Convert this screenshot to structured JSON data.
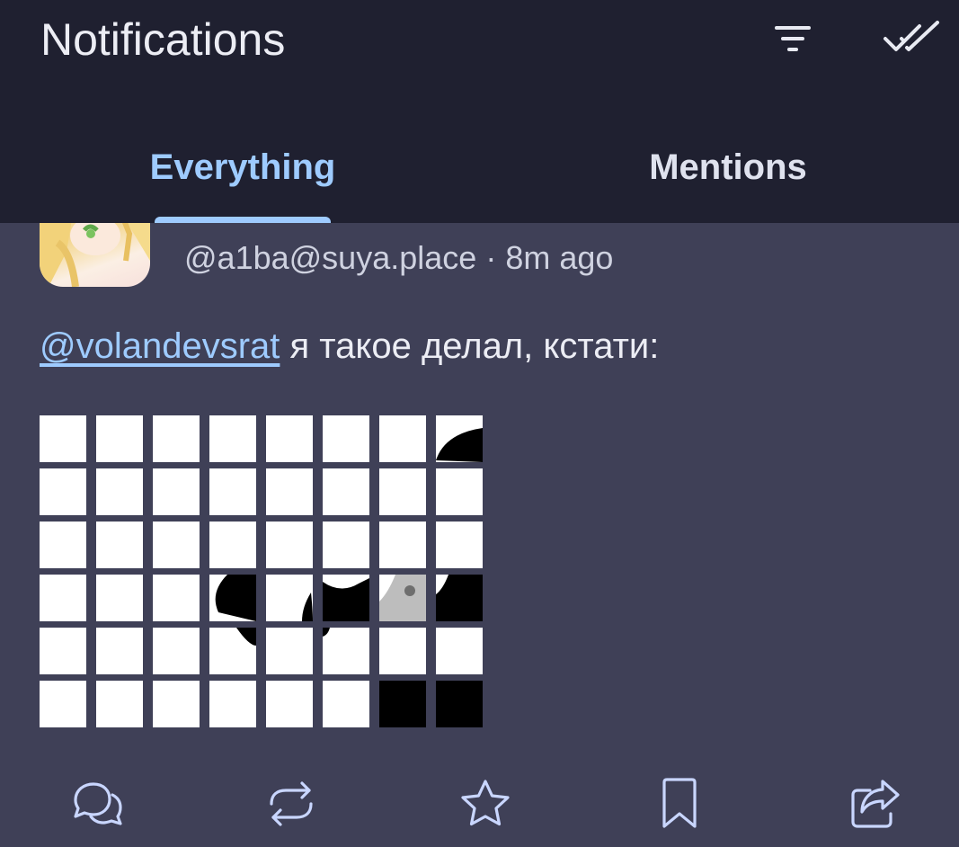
{
  "header": {
    "title": "Notifications",
    "filter_icon": "filter-icon",
    "mark_read_icon": "double-check-icon"
  },
  "tabs": [
    {
      "label": "Everything",
      "active": true
    },
    {
      "label": "Mentions",
      "active": false
    }
  ],
  "post": {
    "handle": "@a1ba@suya.place",
    "separator": "·",
    "time": "8m ago",
    "mention": "@volandevsrat",
    "text": " я такое делал, кстати:",
    "media": {
      "rows": 6,
      "cols": 8
    }
  },
  "actions": [
    "reply-icon",
    "boost-icon",
    "favourite-icon",
    "bookmark-icon",
    "share-icon"
  ],
  "colors": {
    "accent": "#9ecbff",
    "header_bg": "#1f2030",
    "content_bg": "#3f4057"
  }
}
